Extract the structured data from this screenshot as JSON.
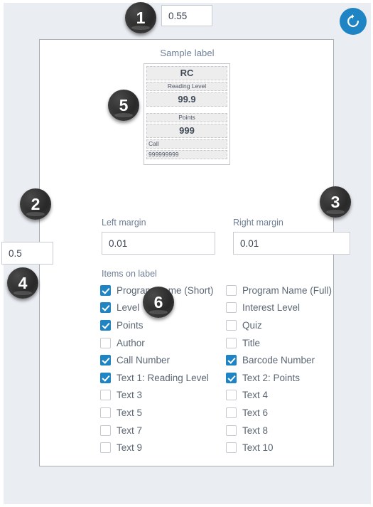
{
  "toolbar": {
    "scale_value": "0.55",
    "reset_icon": "refresh-ccw-icon"
  },
  "sample": {
    "title": "Sample label",
    "rows": [
      {
        "text": "RC",
        "size": "big",
        "align": "center"
      },
      {
        "text": "Reading Level",
        "size": "small",
        "align": "center"
      },
      {
        "text": "99.9",
        "size": "big",
        "align": "center"
      },
      {
        "text": "Points",
        "size": "small",
        "align": "center"
      },
      {
        "text": "999",
        "size": "big",
        "align": "center"
      },
      {
        "text": "Call",
        "size": "small",
        "align": "left"
      },
      {
        "text": "999999999",
        "size": "small",
        "align": "left"
      }
    ]
  },
  "margins": {
    "left_label": "Left margin",
    "left_value": "0.01",
    "right_label": "Right margin",
    "right_value": "0.01"
  },
  "edge_field": {
    "value": "0.5"
  },
  "items": {
    "heading": "Items on label",
    "left_column": [
      {
        "label": "Program Name (Short)",
        "checked": true
      },
      {
        "label": "Level",
        "checked": true
      },
      {
        "label": "Points",
        "checked": true
      },
      {
        "label": "Author",
        "checked": false
      },
      {
        "label": "Call Number",
        "checked": true
      },
      {
        "label": "Text 1: Reading Level",
        "checked": true
      },
      {
        "label": "Text 3",
        "checked": false
      },
      {
        "label": "Text 5",
        "checked": false
      },
      {
        "label": "Text 7",
        "checked": false
      },
      {
        "label": "Text 9",
        "checked": false
      }
    ],
    "right_column": [
      {
        "label": "Program Name (Full)",
        "checked": false
      },
      {
        "label": "Interest Level",
        "checked": false
      },
      {
        "label": "Quiz",
        "checked": false
      },
      {
        "label": "Title",
        "checked": false
      },
      {
        "label": "Barcode Number",
        "checked": true
      },
      {
        "label": "Text 2: Points",
        "checked": true
      },
      {
        "label": "Text 4",
        "checked": false
      },
      {
        "label": "Text 6",
        "checked": false
      },
      {
        "label": "Text 8",
        "checked": false
      },
      {
        "label": "Text 10",
        "checked": false
      }
    ]
  },
  "badges": [
    {
      "number": "1"
    },
    {
      "number": "2"
    },
    {
      "number": "3"
    },
    {
      "number": "4"
    },
    {
      "number": "5"
    },
    {
      "number": "6"
    }
  ],
  "colors": {
    "accent": "#1f84c4",
    "app_background": "#eaedf2",
    "label_text": "#6e7f95",
    "badge": "#2a2a2a"
  }
}
